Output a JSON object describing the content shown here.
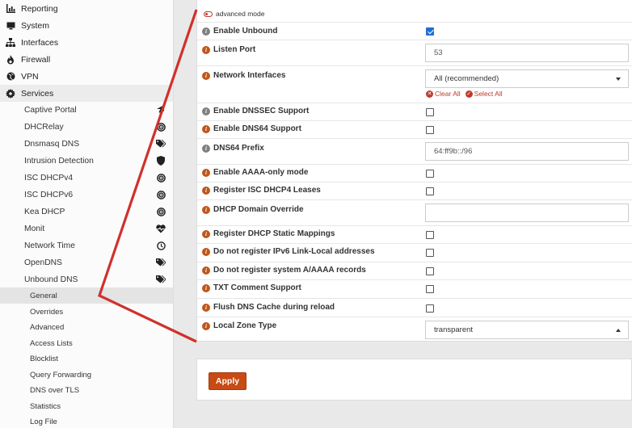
{
  "sidebar": {
    "top_items": [
      {
        "label": "Reporting",
        "icon": "bar-chart-icon"
      },
      {
        "label": "System",
        "icon": "monitor-icon"
      },
      {
        "label": "Interfaces",
        "icon": "sitemap-icon"
      },
      {
        "label": "Firewall",
        "icon": "fire-icon"
      },
      {
        "label": "VPN",
        "icon": "globe-icon"
      },
      {
        "label": "Services",
        "icon": "gear-icon"
      }
    ],
    "service_items": [
      {
        "label": "Captive Portal",
        "icon": "pointer-icon"
      },
      {
        "label": "DHCRelay",
        "icon": "bullseye-icon"
      },
      {
        "label": "Dnsmasq DNS",
        "icon": "tags-icon"
      },
      {
        "label": "Intrusion Detection",
        "icon": "shield-icon"
      },
      {
        "label": "ISC DHCPv4",
        "icon": "bullseye-icon"
      },
      {
        "label": "ISC DHCPv6",
        "icon": "bullseye-icon"
      },
      {
        "label": "Kea DHCP",
        "icon": "bullseye-icon"
      },
      {
        "label": "Monit",
        "icon": "heartbeat-icon"
      },
      {
        "label": "Network Time",
        "icon": "clock-icon"
      },
      {
        "label": "OpenDNS",
        "icon": "tags-icon"
      },
      {
        "label": "Unbound DNS",
        "icon": "tags-icon"
      }
    ],
    "unbound_items": [
      {
        "label": "General"
      },
      {
        "label": "Overrides"
      },
      {
        "label": "Advanced"
      },
      {
        "label": "Access Lists"
      },
      {
        "label": "Blocklist"
      },
      {
        "label": "Query Forwarding"
      },
      {
        "label": "DNS over TLS"
      },
      {
        "label": "Statistics"
      },
      {
        "label": "Log File"
      }
    ]
  },
  "form": {
    "advanced_mode_label": "advanced mode",
    "enable_unbound": "Enable Unbound",
    "listen_port": "Listen Port",
    "listen_port_value": "53",
    "network_interfaces": "Network Interfaces",
    "network_interfaces_value": "All (recommended)",
    "clear_all": "Clear All",
    "select_all": "Select All",
    "enable_dnssec": "Enable DNSSEC Support",
    "enable_dns64": "Enable DNS64 Support",
    "dns64_prefix": "DNS64 Prefix",
    "dns64_prefix_value": "64:ff9b::/96",
    "enable_aaaa_only": "Enable AAAA-only mode",
    "register_isc_dhcp4": "Register ISC DHCP4 Leases",
    "dhcp_domain_override": "DHCP Domain Override",
    "dhcp_domain_override_value": "",
    "register_dhcp_static": "Register DHCP Static Mappings",
    "no_register_ipv6_ll": "Do not register IPv6 Link-Local addresses",
    "no_register_system_a": "Do not register system A/AAAA records",
    "txt_comment_support": "TXT Comment Support",
    "flush_dns_cache": "Flush DNS Cache during reload",
    "local_zone_type": "Local Zone Type",
    "local_zone_type_value": "transparent",
    "info_glyph": "i"
  },
  "apply_label": "Apply",
  "colors": {
    "accent": "#c84a14",
    "annotation": "#d0312d",
    "checkbox_checked": "#1f6fd1"
  }
}
